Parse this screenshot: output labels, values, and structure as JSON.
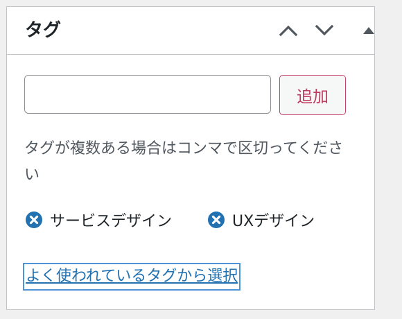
{
  "panel": {
    "title": "タグ",
    "move_up_icon": "chevron-up-icon",
    "move_down_icon": "chevron-down-icon",
    "toggle_icon": "triangle-up-icon"
  },
  "tag_form": {
    "input_value": "",
    "add_label": "追加",
    "help_text": "タグが複数ある場合はコンマで区切ってください"
  },
  "tags": [
    {
      "label": "サービスデザイン",
      "remove_icon": "remove-circle-x-icon"
    },
    {
      "label": "UXデザイン",
      "remove_icon": "remove-circle-x-icon"
    }
  ],
  "popular_link": "よく使われているタグから選択",
  "colors": {
    "accent_blue": "#2271b1",
    "add_button_text": "#c0395f",
    "border": "#c3c4c7"
  }
}
